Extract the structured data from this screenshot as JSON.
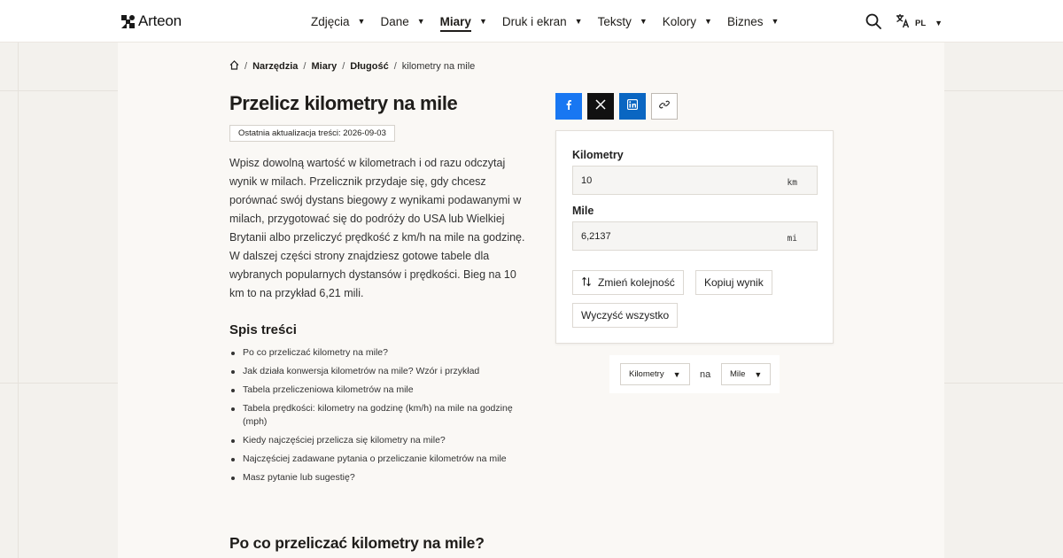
{
  "header": {
    "brand": "Arteon",
    "nav": [
      {
        "label": "Zdjęcia",
        "active": false
      },
      {
        "label": "Dane",
        "active": false
      },
      {
        "label": "Miary",
        "active": true
      },
      {
        "label": "Druk i ekran",
        "active": false
      },
      {
        "label": "Teksty",
        "active": false
      },
      {
        "label": "Kolory",
        "active": false
      },
      {
        "label": "Biznes",
        "active": false
      }
    ],
    "language": "PL",
    "caret": "▼"
  },
  "breadcrumb": {
    "items": [
      "Narzędzia",
      "Miary",
      "Długość"
    ],
    "current": "kilometry na mile",
    "separator": "/"
  },
  "page": {
    "title": "Przelicz kilometry na mile",
    "updated": "Ostatnia aktualizacja treści: 2026-09-03",
    "intro": "Wpisz dowolną wartość w kilometrach i od razu odczytaj wynik w milach. Przelicznik przydaje się, gdy chcesz porównać swój dystans biegowy z wynikami podawanymi w milach, przygotować się do podróży do USA lub Wielkiej Brytanii albo przeliczyć prędkość z km/h na mile na godzinę. W dalszej części strony znajdziesz gotowe tabele dla wybranych popularnych dystansów i prędkości. Bieg na 10 km to na przykład 6,21 mili.",
    "section_title": "Po co przeliczać kilometry na mile?"
  },
  "toc": {
    "title": "Spis treści",
    "items": [
      "Po co przeliczać kilometry na mile?",
      "Jak działa konwersja kilometrów na mile? Wzór i przykład",
      "Tabela przeliczeniowa kilometrów na mile",
      "Tabela prędkości: kilometry na godzinę (km/h) na mile na godzinę (mph)",
      "Kiedy najczęściej przelicza się kilometry na mile?",
      "Najczęściej zadawane pytania o przeliczanie kilometrów na mile",
      "Masz pytanie lub sugestię?"
    ]
  },
  "converter": {
    "from_label": "Kilometry",
    "from_value": "10",
    "from_unit": "km",
    "to_label": "Mile",
    "to_value": "6,2137",
    "to_unit": "mi",
    "swap_label": "Zmień kolejność",
    "copy_label": "Kopiuj wynik",
    "clear_label": "Wyczyść wszystko"
  },
  "unit_selector": {
    "from": "Kilometry",
    "connector": "na",
    "to": "Mile"
  },
  "colors": {
    "facebook": "#1877f2",
    "x": "#111111",
    "linkedin": "#0a66c2",
    "page_bg": "#f3f1ed"
  },
  "icons": {
    "logo": "arteon-logo-icon",
    "search": "search-icon",
    "language": "translate-icon",
    "home": "home-icon",
    "facebook": "facebook-icon",
    "x": "x-icon",
    "linkedin": "linkedin-icon",
    "link": "link-icon",
    "swap": "swap-vertical-icon"
  }
}
